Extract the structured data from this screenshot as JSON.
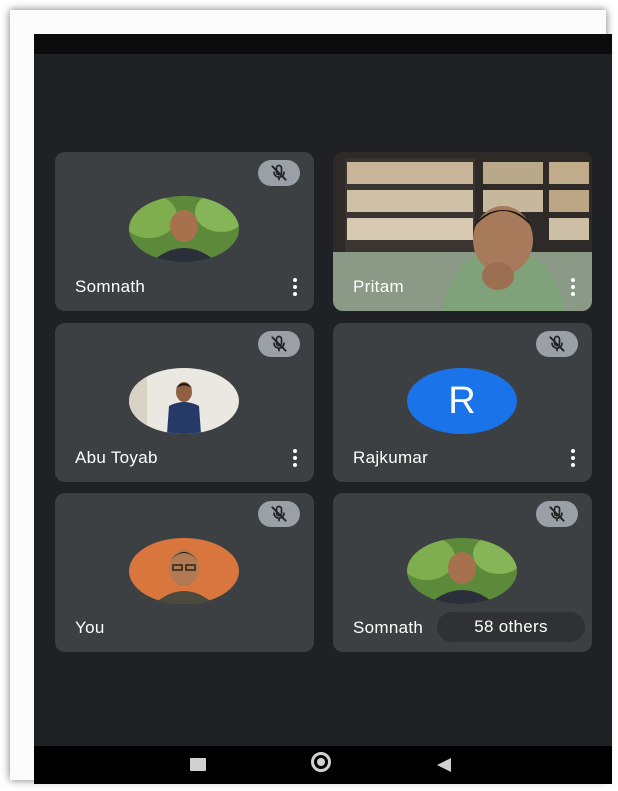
{
  "participants": [
    {
      "name": "Somnath",
      "muted": true,
      "avatar": "photo-man-green-background"
    },
    {
      "name": "Pritam",
      "muted": false,
      "avatar": "video-feed-bookshelf"
    },
    {
      "name": "Abu Toyab",
      "muted": true,
      "avatar": "photo-man-standing-white-wall"
    },
    {
      "name": "Rajkumar",
      "muted": true,
      "avatar": "letter",
      "initial": "R",
      "color": "#1a73e8"
    },
    {
      "name": "You",
      "muted": true,
      "avatar": "photo-man-glasses-orange-background"
    },
    {
      "name": "Somnath",
      "muted": true,
      "avatar": "photo-man-green-background",
      "others_label": "58 others"
    }
  ],
  "icons": {
    "mute": "mic-off-icon",
    "more": "more-vert-icon",
    "nav_recents": "square-icon",
    "nav_home": "circle-icon",
    "nav_back": "triangle-back-icon"
  },
  "colors": {
    "background": "#202124",
    "tile": "#3c4043",
    "mute_badge": "#9aa0a6",
    "initial_avatar": "#1a73e8"
  }
}
